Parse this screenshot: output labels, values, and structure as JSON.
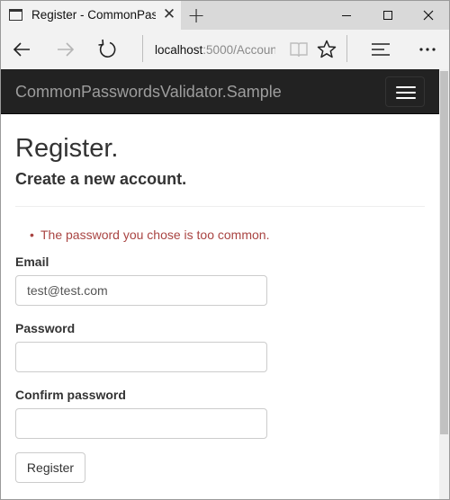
{
  "browser": {
    "tab_title": "Register - CommonPass",
    "tab_close_glyph": "✕",
    "new_tab_glyph": "+",
    "address_host": "localhost",
    "address_rest": ":5000/Accoun"
  },
  "icons": {
    "tab": "window-icon",
    "back": "arrow-left-icon",
    "forward": "arrow-right-icon",
    "refresh": "refresh-icon",
    "reading": "reading-view-icon",
    "favorite": "star-icon",
    "hub": "hub-icon",
    "more": "more-icon",
    "menu": "hamburger-icon"
  },
  "app": {
    "brand": "CommonPasswordsValidator.Sample"
  },
  "page": {
    "title": "Register.",
    "subtitle": "Create a new account.",
    "validation_errors": [
      "The password you chose is too common."
    ],
    "bullet": "•"
  },
  "form": {
    "email_label": "Email",
    "email_value": "test@test.com",
    "password_label": "Password",
    "password_value": "",
    "confirm_label": "Confirm password",
    "confirm_value": "",
    "submit_label": "Register"
  },
  "colors": {
    "navbar_bg": "#222222",
    "brand_text": "#9d9d9d",
    "error_text": "#a94442",
    "input_border": "#cccccc"
  }
}
